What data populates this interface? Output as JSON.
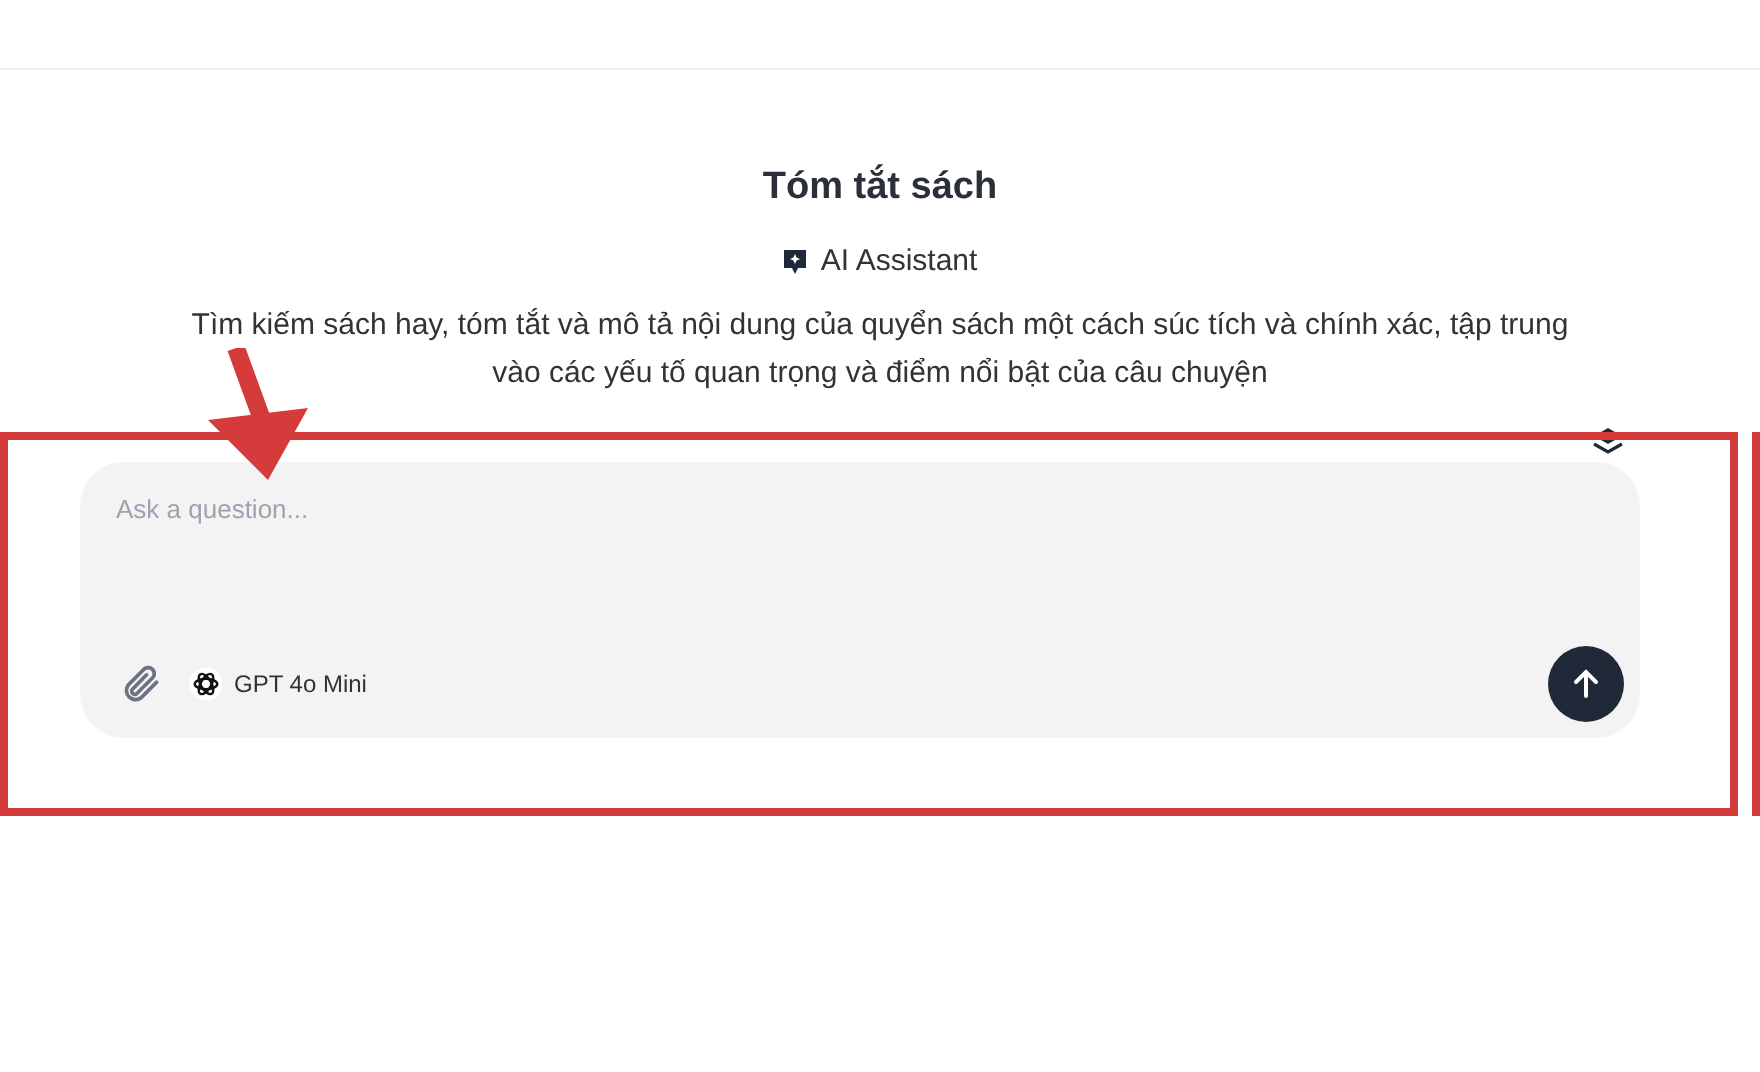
{
  "header": {
    "title": "Tóm tắt sách",
    "badge": "AI Assistant",
    "description": "Tìm kiếm sách hay, tóm tắt và mô tả nội dung của quyển sách một cách súc tích và chính xác, tập trung vào các yếu tố quan trọng và điểm nổi bật của câu chuyện"
  },
  "composer": {
    "placeholder": "Ask a question...",
    "model": "GPT 4o Mini"
  }
}
